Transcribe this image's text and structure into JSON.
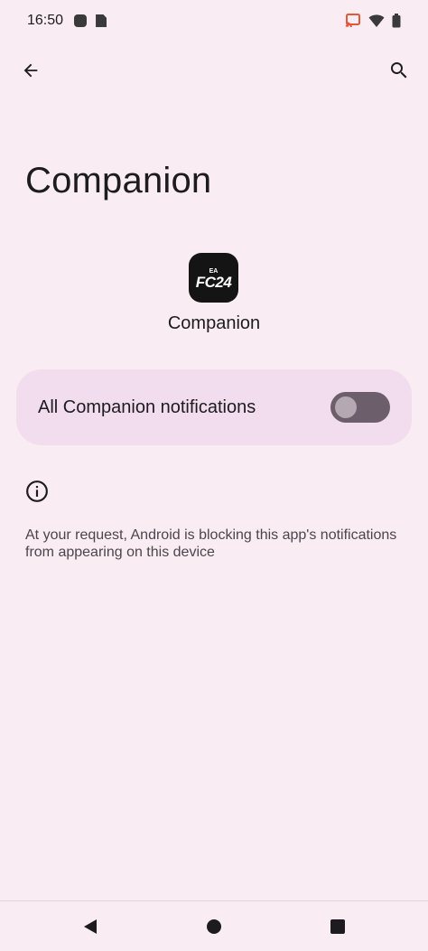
{
  "status_bar": {
    "time": "16:50",
    "icons": [
      "notification-dot-icon",
      "sim-alert-icon",
      "cast-icon",
      "wifi-icon",
      "battery-icon"
    ]
  },
  "top_bar": {
    "back_icon": "arrow-back-icon",
    "search_icon": "search-icon"
  },
  "page": {
    "title": "Companion"
  },
  "app": {
    "name": "Companion",
    "icon": {
      "badge_text": "EA",
      "logo_text": "FC24"
    }
  },
  "notifications_toggle": {
    "label": "All Companion notifications",
    "enabled": false
  },
  "info": {
    "icon": "info-icon",
    "text": "At your request, Android is blocking this app's notifications from appearing on this device"
  },
  "nav_bar": {
    "back": "nav-back-icon",
    "home": "nav-home-icon",
    "recents": "nav-recents-icon"
  },
  "colors": {
    "background": "#f9edf3",
    "card": "#f1ddee",
    "switch_track": "#6d5e6b",
    "switch_thumb": "#b4a8b3"
  }
}
